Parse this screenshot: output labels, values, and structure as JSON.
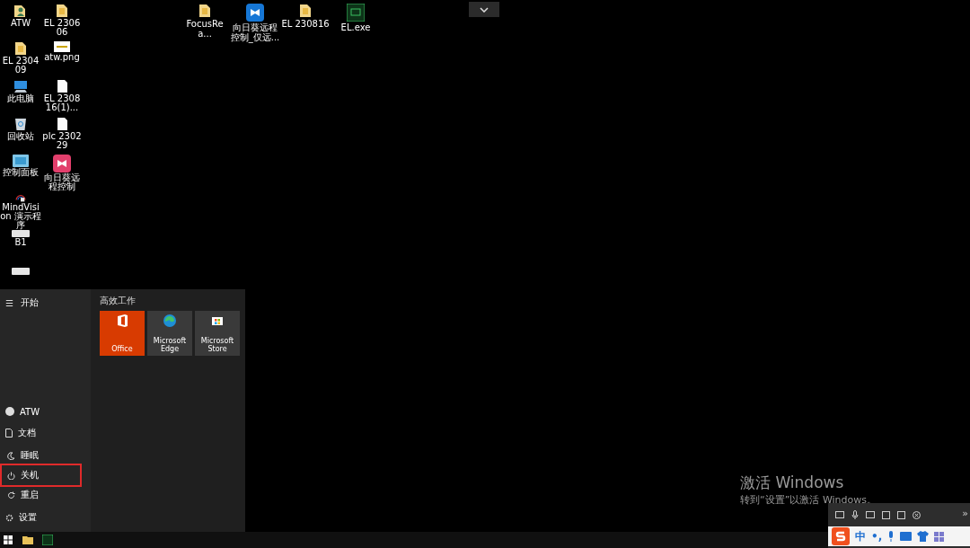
{
  "desktop_icons_left": [
    {
      "kind": "folder-user",
      "label": "ATW"
    },
    {
      "kind": "folder",
      "label": "EL 230606"
    },
    {
      "kind": "folder",
      "label": "EL 230409"
    },
    {
      "kind": "image",
      "label": "atw.png"
    },
    {
      "kind": "pc",
      "label": "此电脑"
    },
    {
      "kind": "file",
      "label": "EL 230816(1)..."
    },
    {
      "kind": "recycle",
      "label": "回收站"
    },
    {
      "kind": "file",
      "label": "plc 230229"
    },
    {
      "kind": "panel",
      "label": "控制面板"
    },
    {
      "kind": "app-pink",
      "label": "向日葵远程控制"
    },
    {
      "kind": "mindvision",
      "label": "MindVision 演示程序"
    },
    {
      "kind": "none"
    },
    {
      "kind": "drive",
      "label": "B1"
    },
    {
      "kind": "none"
    },
    {
      "kind": "drive"
    }
  ],
  "desktop_icons_top": [
    {
      "kind": "folder",
      "label": "FocusRea..."
    },
    {
      "kind": "app-blue",
      "label": "向日葵远程控制_仅远..."
    },
    {
      "kind": "folder",
      "label": "EL 230816"
    },
    {
      "kind": "exe",
      "label": "EL.exe"
    }
  ],
  "start_menu": {
    "menu_glyph": "☰",
    "title": "开始",
    "group_title": "高效工作",
    "tiles": [
      {
        "kind": "office",
        "label": "Office"
      },
      {
        "kind": "edge",
        "label": "Microsoft Edge"
      },
      {
        "kind": "store",
        "label": "Microsoft Store"
      }
    ],
    "left_items": [
      {
        "kind": "user",
        "label": "ATW"
      },
      {
        "kind": "doc",
        "label": "文档"
      }
    ],
    "power_options": [
      {
        "kind": "sleep",
        "label": "睡眠",
        "highlighted": false
      },
      {
        "kind": "power",
        "label": "关机",
        "highlighted": true
      },
      {
        "kind": "restart",
        "label": "重启",
        "highlighted": false
      }
    ],
    "bottom_items": [
      {
        "kind": "gear",
        "label": "设置"
      }
    ]
  },
  "activation": {
    "title": "激活 Windows",
    "subtitle": "转到“设置”以激活 Windows。"
  },
  "ime_bar": {
    "mode": "中",
    "punct": "•,",
    "expand": "»"
  }
}
